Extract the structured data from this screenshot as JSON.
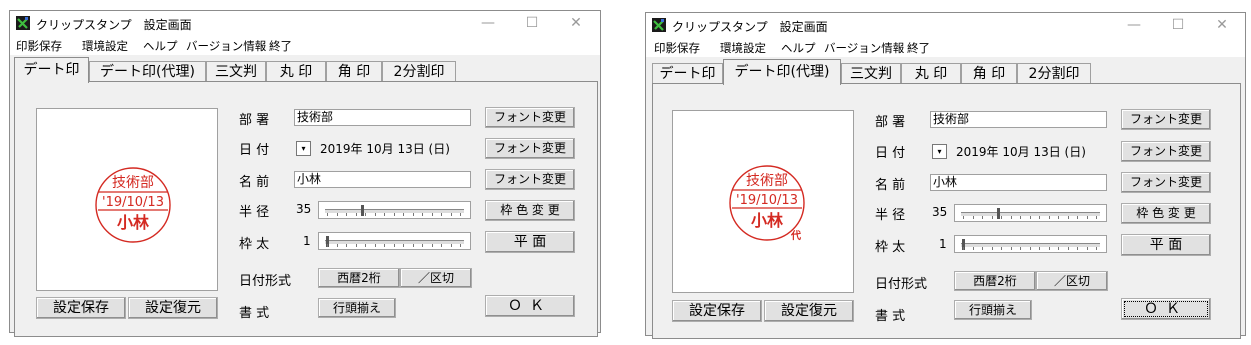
{
  "colors": {
    "stamp_red": "#d42a22",
    "window_bg": "#f0f0f0"
  },
  "windows": [
    {
      "title": "クリップスタンプ　設定画面",
      "window_controls": {
        "minimize": "—",
        "maximize": "☐",
        "close": "✕"
      },
      "menu": [
        "印影保存",
        "環境設定",
        "ヘルプ",
        "バージョン情報",
        "終了"
      ],
      "tabs": [
        "デート印",
        "デート印(代理)",
        "三文判",
        "丸 印",
        "角 印",
        "2分割印"
      ],
      "selected_tab": 0,
      "stamp": {
        "top": "技術部",
        "middle": "'19/10/13",
        "bottom": "小林",
        "proxy_mark": ""
      },
      "fields": {
        "dept_label": "部 署",
        "dept_value": "技術部",
        "date_label": "日 付",
        "date_value": "2019年 10月 13日 (日)",
        "name_label": "名 前",
        "name_value": "小林",
        "radius_label": "半 径",
        "radius_value": "35",
        "frame_label": "枠 太",
        "frame_value": "1",
        "date_format_label": "日付形式",
        "format_label": "書 式"
      },
      "buttons": {
        "font1": "フォント変更",
        "font2": "フォント変更",
        "font3": "フォント変更",
        "frame_color": "枠 色 変 更",
        "flat": "平 面",
        "ok": "ＯＫ",
        "save": "設定保存",
        "restore": "設定復元"
      },
      "date_format_options": [
        "西暦2桁",
        "／区切"
      ],
      "format_option": "行頭揃え"
    },
    {
      "title": "クリップスタンプ　設定画面",
      "window_controls": {
        "minimize": "—",
        "maximize": "☐",
        "close": "✕"
      },
      "menu": [
        "印影保存",
        "環境設定",
        "ヘルプ",
        "バージョン情報",
        "終了"
      ],
      "tabs": [
        "デート印",
        "デート印(代理)",
        "三文判",
        "丸 印",
        "角 印",
        "2分割印"
      ],
      "selected_tab": 1,
      "stamp": {
        "top": "技術部",
        "middle": "'19/10/13",
        "bottom": "小林",
        "proxy_mark": "代"
      },
      "fields": {
        "dept_label": "部 署",
        "dept_value": "技術部",
        "date_label": "日 付",
        "date_value": "2019年 10月 13日 (日)",
        "name_label": "名 前",
        "name_value": "小林",
        "radius_label": "半 径",
        "radius_value": "35",
        "frame_label": "枠 太",
        "frame_value": "1",
        "date_format_label": "日付形式",
        "format_label": "書 式"
      },
      "buttons": {
        "font1": "フォント変更",
        "font2": "フォント変更",
        "font3": "フォント変更",
        "frame_color": "枠 色 変 更",
        "flat": "平 面",
        "ok": "ＯＫ",
        "save": "設定保存",
        "restore": "設定復元"
      },
      "date_format_options": [
        "西暦2桁",
        "／区切"
      ],
      "format_option": "行頭揃え"
    }
  ]
}
